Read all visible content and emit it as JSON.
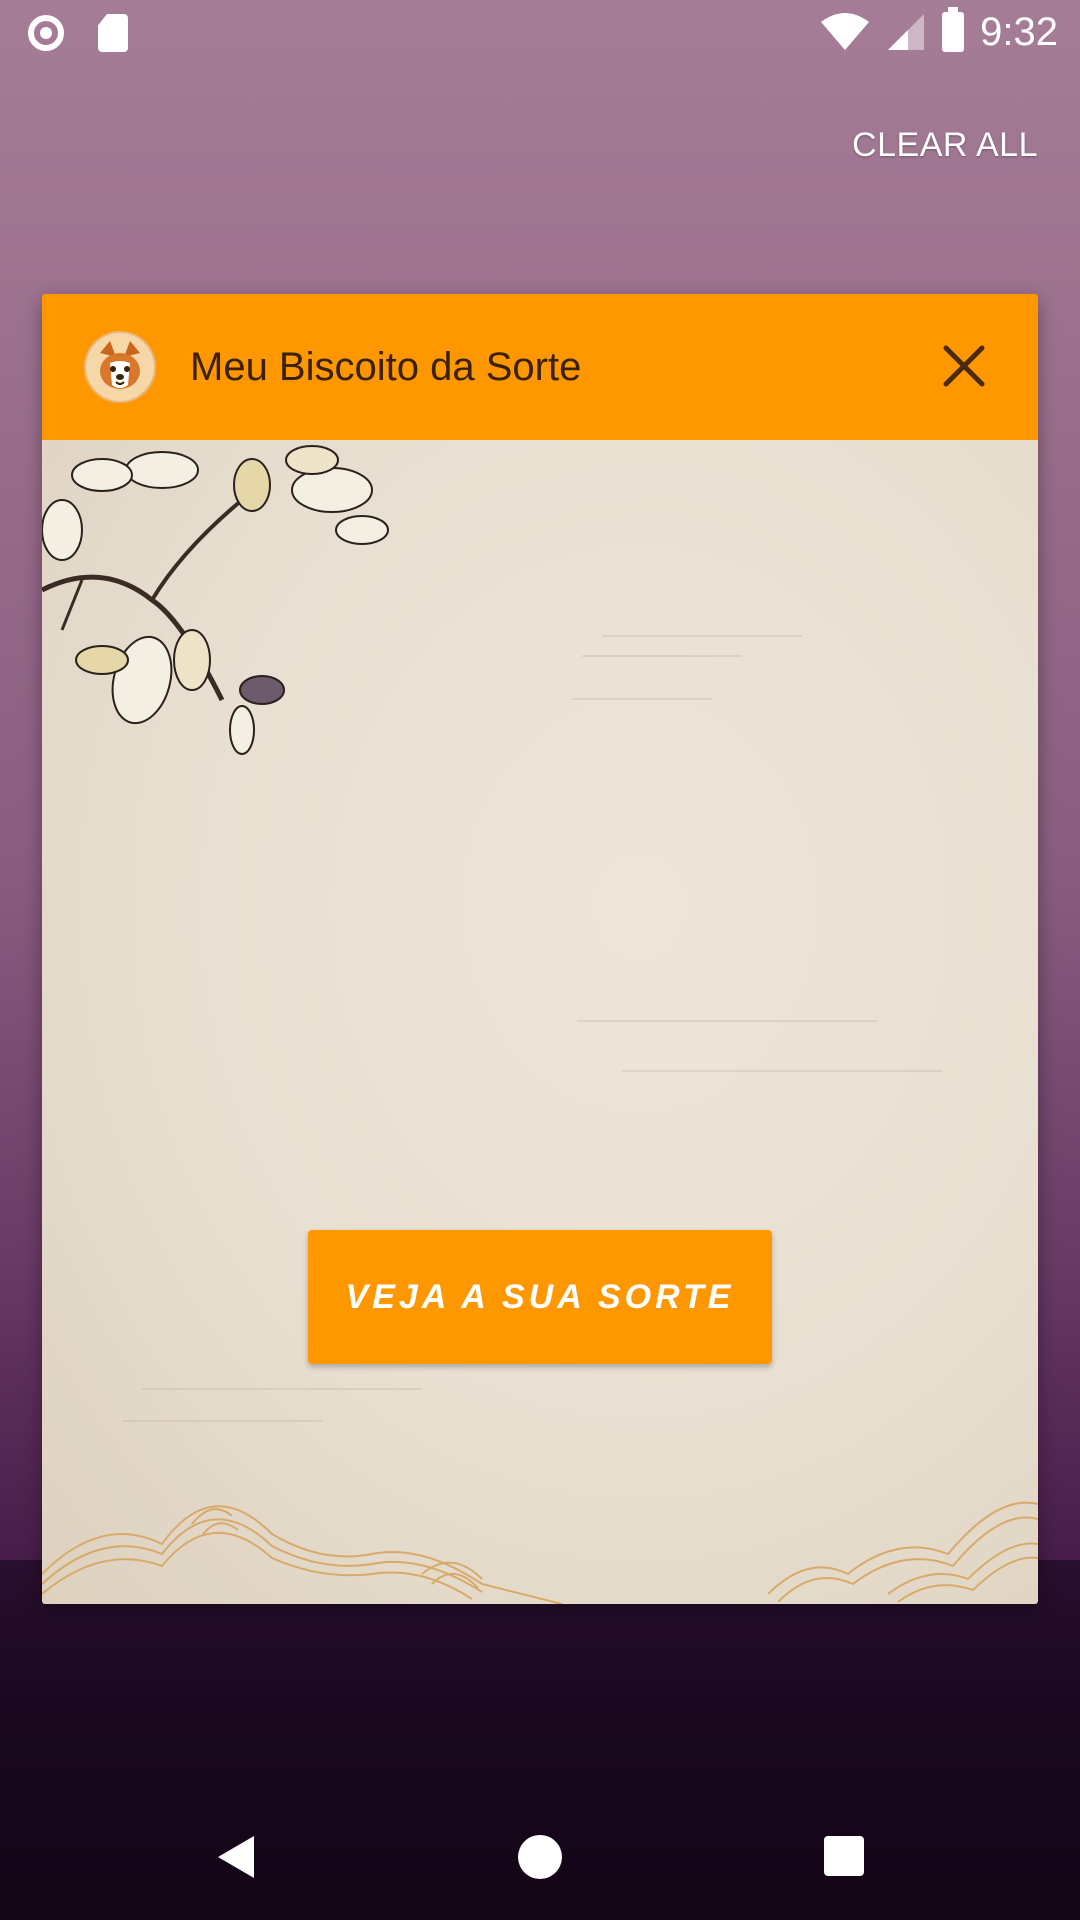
{
  "status_bar": {
    "time": "9:32",
    "left_icons": [
      "record-icon",
      "sd-card-icon"
    ],
    "right_icons": [
      "wifi-icon",
      "cell-signal-icon",
      "battery-icon"
    ]
  },
  "recents": {
    "clear_all_label": "CLEAR ALL"
  },
  "app_card": {
    "title": "Meu Biscoito da Sorte",
    "icon": "corgi-icon",
    "close_icon": "close-icon",
    "header_color": "#ff9800",
    "button_label": "VEJA A SUA SORTE"
  },
  "nav_bar": {
    "icons": [
      "back-icon",
      "home-icon",
      "recents-icon"
    ]
  }
}
